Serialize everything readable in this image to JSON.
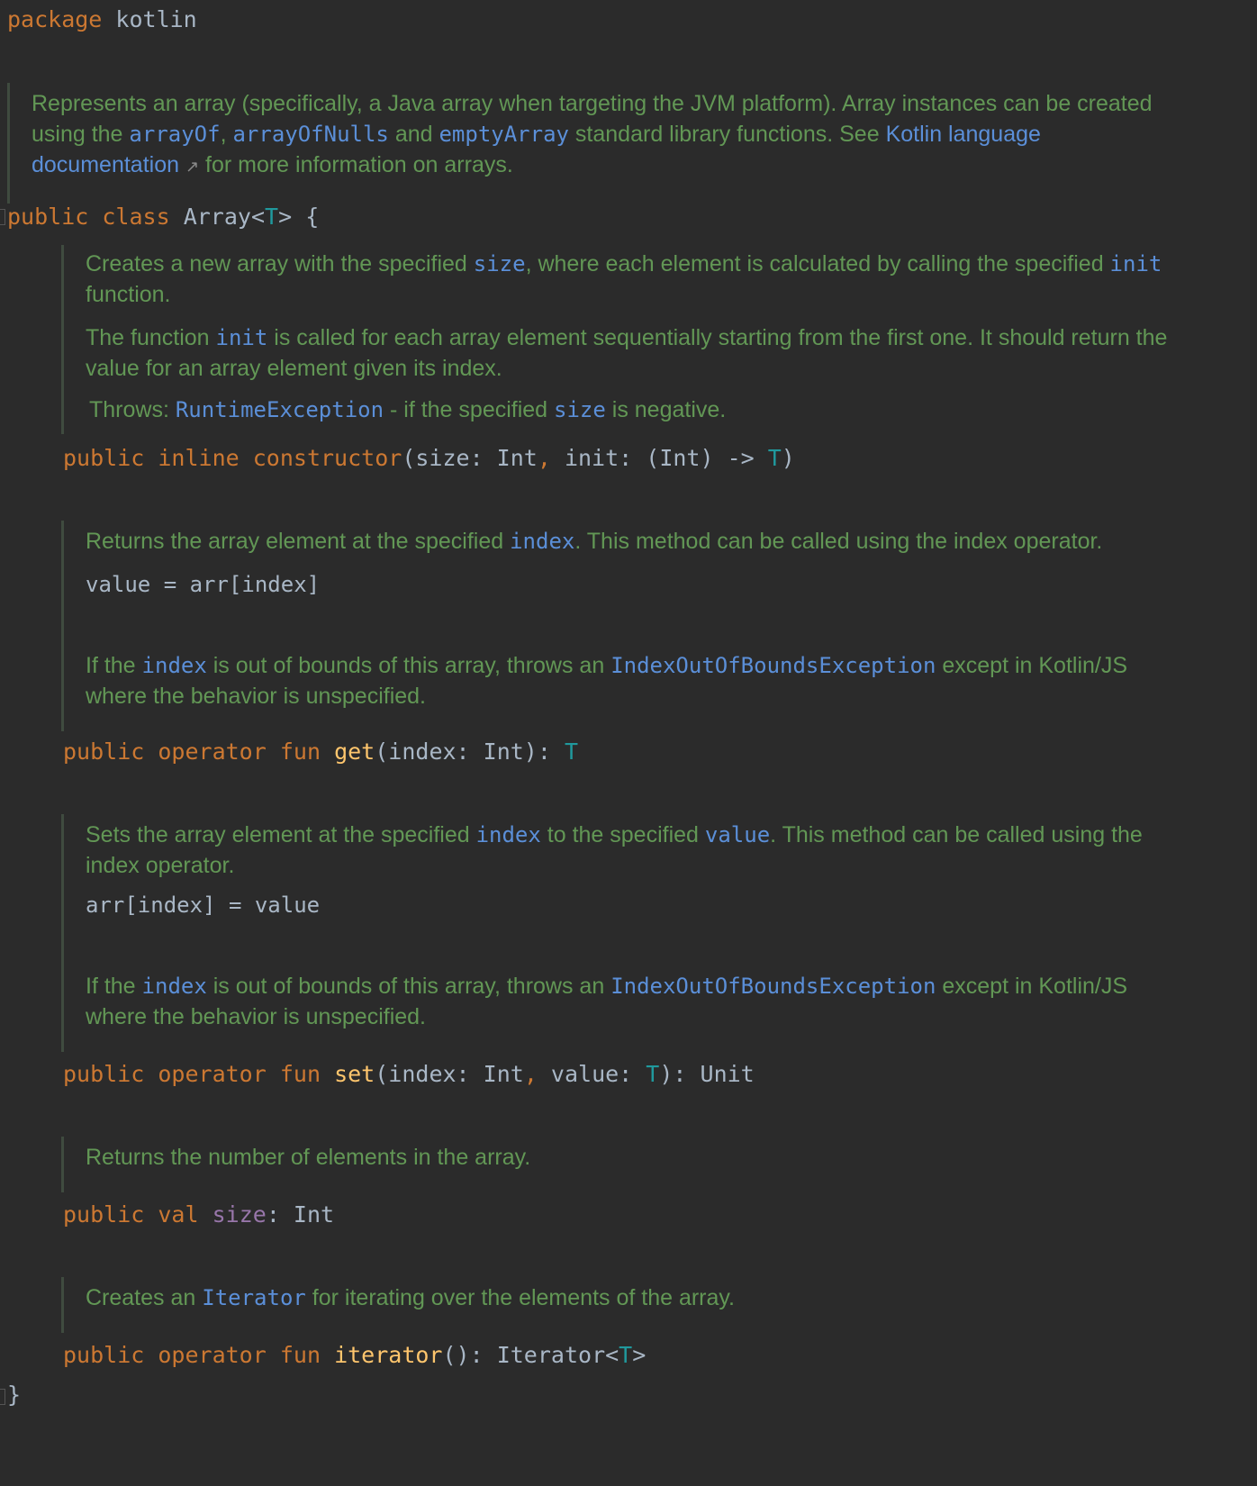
{
  "package_line": {
    "kw": "package",
    "name": "kotlin"
  },
  "class_doc": {
    "t1": "Represents an array (specifically, a Java array when targeting the JVM platform). Array instances can be created using the ",
    "ref_arrayOf": "arrayOf",
    "t2": ", ",
    "ref_arrayOfNulls": "arrayOfNulls",
    "t3": " and ",
    "ref_emptyArray": "emptyArray",
    "t4": " standard library functions. See ",
    "link_text": "Kotlin language documentation",
    "link_arrow": "↗",
    "t5": " for more information on arrays."
  },
  "class_decl": {
    "kw1": "public",
    "kw2": "class",
    "name": "Array",
    "type_param": "T",
    "brace_open": "{",
    "brace_close": "}"
  },
  "constructor_doc": {
    "p1a": "Creates a new array with the specified ",
    "p1_size": "size",
    "p1b": ", where each element is calculated by calling the specified ",
    "p1_init": "init",
    "p1c": " function.",
    "p2a": "The function ",
    "p2_init": "init",
    "p2b": " is called for each array element sequentially starting from the first one. It should return the value for an array element given its index.",
    "throws_label": "Throws: ",
    "throws_type": "RuntimeException",
    "throws_a": " - if the specified ",
    "throws_size": "size",
    "throws_b": " is negative."
  },
  "constructor_sig": {
    "kw1": "public",
    "kw2": "inline",
    "name": "constructor",
    "params": "(size: Int",
    "comma": ",",
    "params2": " init: (Int) -> ",
    "type": "T",
    "close": ")"
  },
  "get_doc": {
    "p1a": "Returns the array element at the specified ",
    "p1_index": "index",
    "p1b": ". This method can be called using the index operator.",
    "example": "value = arr[index]",
    "p2a": "If the ",
    "p2_index": "index",
    "p2b": " is out of bounds of this array, throws an ",
    "p2_exc": "IndexOutOfBoundsException",
    "p2c": " except in Kotlin/JS where the behavior is unspecified."
  },
  "get_sig": {
    "kw1": "public",
    "kw2": "operator",
    "kw3": "fun",
    "name": "get",
    "params": "(index: Int): ",
    "type": "T"
  },
  "set_doc": {
    "p1a": "Sets the array element at the specified ",
    "p1_index": "index",
    "p1b": " to the specified ",
    "p1_value": "value",
    "p1c": ". This method can be called using the index operator.",
    "example": "arr[index] = value",
    "p2a": "If the ",
    "p2_index": "index",
    "p2b": " is out of bounds of this array, throws an ",
    "p2_exc": "IndexOutOfBoundsException",
    "p2c": " except in Kotlin/JS where the behavior is unspecified."
  },
  "set_sig": {
    "kw1": "public",
    "kw2": "operator",
    "kw3": "fun",
    "name": "set",
    "params": "(index: Int",
    "comma": ",",
    "params2": " value: ",
    "type": "T",
    "close": "): Unit"
  },
  "size_doc": {
    "text": "Returns the number of elements in the array."
  },
  "size_sig": {
    "kw1": "public",
    "kw2": "val",
    "prop": "size",
    "rest": ": Int"
  },
  "iterator_doc": {
    "a": "Creates an ",
    "ref": "Iterator",
    "b": " for iterating over the elements of the array."
  },
  "iterator_sig": {
    "kw1": "public",
    "kw2": "operator",
    "kw3": "fun",
    "name": "iterator",
    "params": "(): Iterator<",
    "type": "T",
    "close": ">"
  }
}
